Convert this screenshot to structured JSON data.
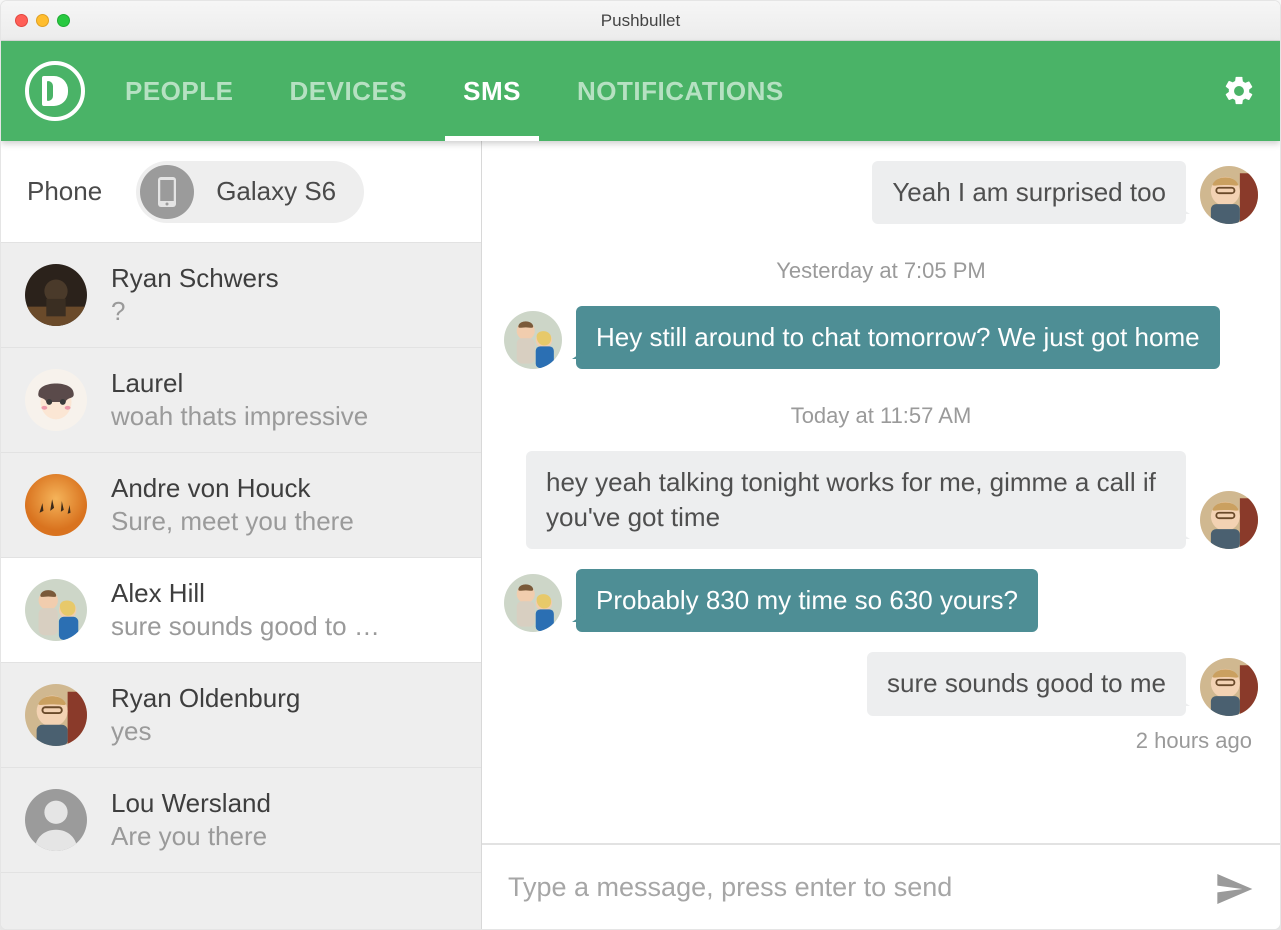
{
  "window": {
    "title": "Pushbullet"
  },
  "nav": {
    "tabs": [
      {
        "label": "PEOPLE",
        "active": false
      },
      {
        "label": "DEVICES",
        "active": false
      },
      {
        "label": "SMS",
        "active": true
      },
      {
        "label": "NOTIFICATIONS",
        "active": false
      }
    ]
  },
  "sidebar": {
    "phone_label": "Phone",
    "device_name": "Galaxy S6",
    "threads": [
      {
        "name": "Ryan Schwers",
        "preview": "?",
        "avatar": "ryan-s",
        "selected": false
      },
      {
        "name": "Laurel",
        "preview": "woah thats impressive",
        "avatar": "laurel",
        "selected": false
      },
      {
        "name": "Andre von Houck",
        "preview": "Sure, meet you there",
        "avatar": "andre",
        "selected": false
      },
      {
        "name": "Alex Hill",
        "preview": "sure sounds good to …",
        "avatar": "alex",
        "selected": true
      },
      {
        "name": "Ryan Oldenburg",
        "preview": "yes",
        "avatar": "ryan-o",
        "selected": false
      },
      {
        "name": "Lou Wersland",
        "preview": "Are you there",
        "avatar": "placeholder",
        "selected": false
      }
    ]
  },
  "chat": {
    "items": [
      {
        "type": "msg",
        "dir": "out",
        "text": "Yeah I am surprised too",
        "avatar": "ryan-o"
      },
      {
        "type": "ts",
        "text": "Yesterday at 7:05 PM"
      },
      {
        "type": "msg",
        "dir": "in",
        "text": "Hey still around to chat tomorrow? We just got home",
        "avatar": "alex"
      },
      {
        "type": "ts",
        "text": "Today at 11:57 AM"
      },
      {
        "type": "msg",
        "dir": "out",
        "text": "hey yeah talking tonight works for me, gimme a call if you've got time",
        "avatar": "ryan-o"
      },
      {
        "type": "msg",
        "dir": "in",
        "text": "Probably 830 my time so 630 yours?",
        "avatar": "alex"
      },
      {
        "type": "msg",
        "dir": "out",
        "text": "sure sounds good to me",
        "avatar": "ryan-o"
      },
      {
        "type": "ago",
        "text": "2 hours ago"
      }
    ],
    "composer_placeholder": "Type a message, press enter to send"
  },
  "avatars": {
    "ryan-s": {
      "bg": "#3a2e26",
      "type": "photo-dark"
    },
    "laurel": {
      "bg": "#f7f2ec",
      "type": "cartoon"
    },
    "andre": {
      "bg": "#e78a2e",
      "type": "orange"
    },
    "alex": {
      "bg": "#d8c5a8",
      "type": "couple"
    },
    "ryan-o": {
      "bg": "#d9c6a9",
      "type": "guy"
    },
    "placeholder": {
      "bg": "#9b9b9b",
      "type": "silhouette"
    }
  }
}
